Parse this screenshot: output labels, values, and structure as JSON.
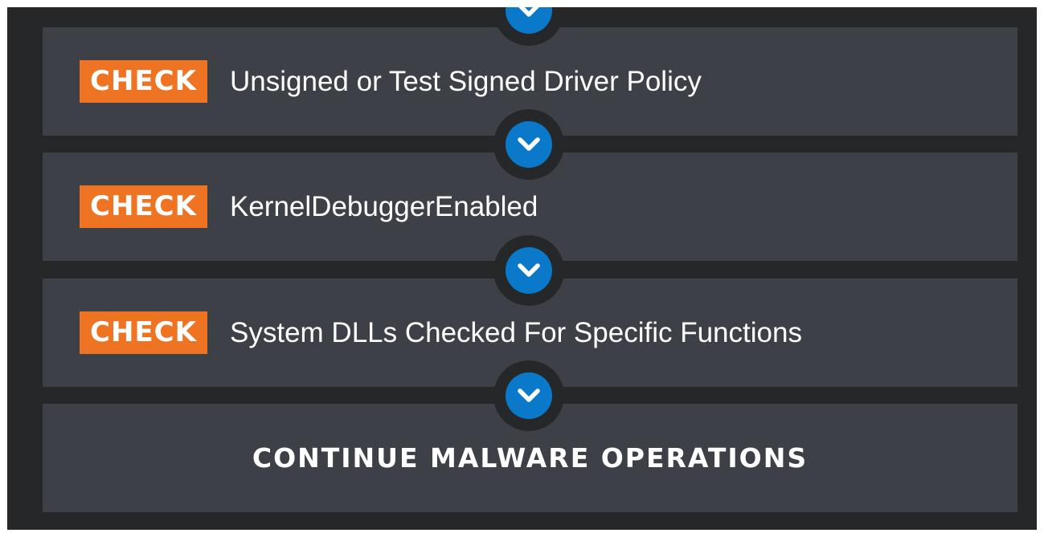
{
  "colors": {
    "background": "#262729",
    "card": "#3e4048",
    "badge": "#ee7322",
    "connector": "#0b79c9",
    "text": "#ffffff"
  },
  "steps": [
    {
      "badge": "CHECK",
      "label": "Unsigned or Test Signed Driver Policy"
    },
    {
      "badge": "CHECK",
      "label": "KernelDebuggerEnabled"
    },
    {
      "badge": "CHECK",
      "label": "System DLLs Checked For Specific Functions"
    }
  ],
  "final_step": {
    "label": "CONTINUE MALWARE OPERATIONS"
  },
  "connector_icon": "chevron-down-icon"
}
